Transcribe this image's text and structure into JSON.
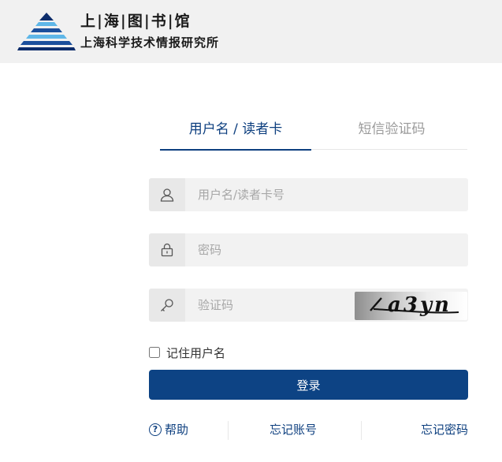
{
  "header": {
    "logo_line1": "上|海|图|书|馆",
    "logo_line2": "上海科学技术情报研究所",
    "brand_colors": [
      "#1b4f9c",
      "#5fb7e8",
      "#0d2d6b"
    ]
  },
  "tabs": [
    {
      "label": "用户名 / 读者卡",
      "active": true
    },
    {
      "label": "短信验证码",
      "active": false
    }
  ],
  "form": {
    "username_placeholder": "用户名/读者卡号",
    "password_placeholder": "密码",
    "captcha_placeholder": "验证码",
    "captcha_text": "a3yn",
    "remember_label": "记住用户名",
    "login_label": "登录"
  },
  "links": {
    "help": "帮助",
    "forgot_account": "忘记账号",
    "forgot_password": "忘记密码"
  },
  "icons": {
    "user": "user-icon",
    "lock": "lock-icon",
    "key": "key-icon",
    "help": "question-circle-icon"
  },
  "colors": {
    "primary": "#0d4384",
    "header_bg": "#f1f1f1",
    "field_bg": "#f2f2f2"
  }
}
